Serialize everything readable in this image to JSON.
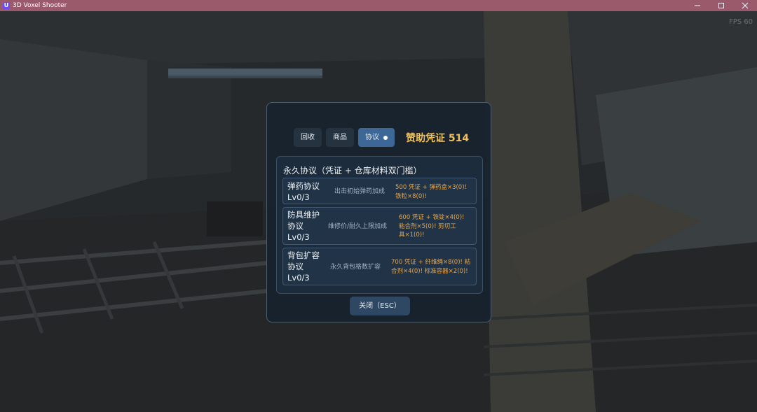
{
  "window": {
    "title": "3D Voxel Shooter",
    "icon_glyph": "U",
    "controls": [
      "minimize-icon",
      "maximize-icon",
      "close-icon"
    ],
    "titlebar_color": "#9a5a6c"
  },
  "hud": {
    "fps_label": "FPS 60"
  },
  "shop": {
    "tabs": [
      {
        "label": "回收",
        "active": false
      },
      {
        "label": "商品",
        "active": false
      },
      {
        "label": "协议",
        "active": true
      }
    ],
    "credits_label": "赞助凭证 514",
    "section_title": "永久协议（凭证 + 仓库材料双门槛）",
    "protocols": [
      {
        "name_lines": [
          "弹药协议",
          "Lv0/3"
        ],
        "desc": "出击初始弹药加成",
        "cost_lines": [
          "500 凭证 + 弹药盒×3(0)!",
          "铁粒×8(0)!"
        ]
      },
      {
        "name_lines": [
          "防具维护",
          "协议",
          "Lv0/3"
        ],
        "desc": "维修价/耐久上限加成",
        "cost_lines": [
          "600 凭证 + 铁锭×4(0)!",
          "粘合剂×5(0)! 剪切工",
          "具×1(0)!"
        ]
      },
      {
        "name_lines": [
          "背包扩容",
          "协议",
          "Lv0/3"
        ],
        "desc": "永久背包格数扩容",
        "cost_lines": [
          "700 凭证 + 纤维绳×8(0)! 粘",
          "合剂×4(0)! 标准容器×2(0)!"
        ]
      }
    ],
    "close_label": "关闭（ESC）",
    "colors": {
      "accent_gold": "#efc05a",
      "cost_orange": "#e7a44c",
      "active_tab": "#3d6796"
    }
  }
}
